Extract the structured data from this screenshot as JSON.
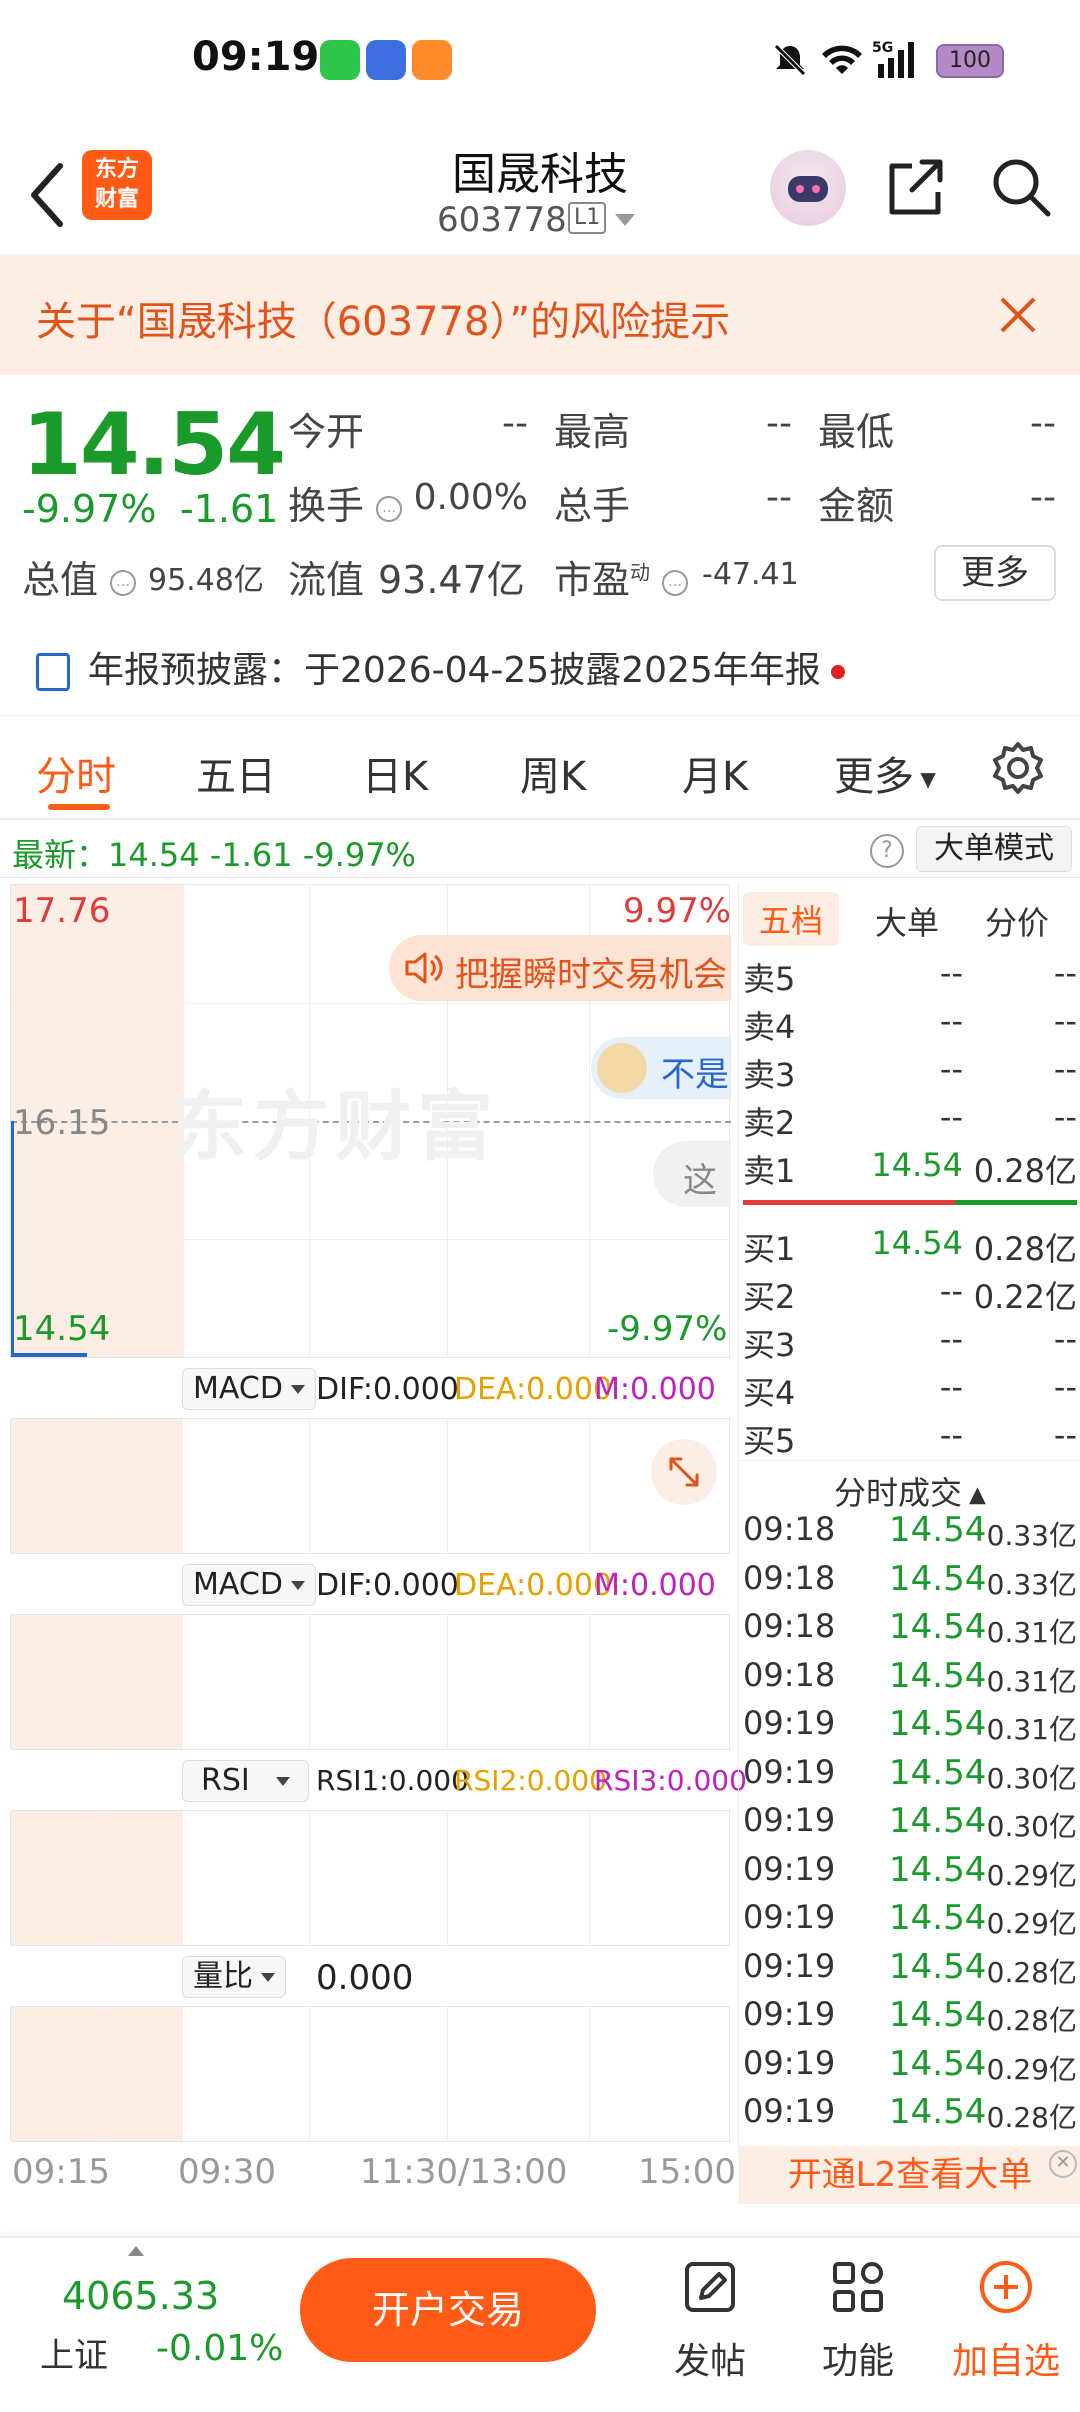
{
  "status_bar": {
    "time": "09:19",
    "battery": "100"
  },
  "header": {
    "logo": "东方\n财富",
    "title": "国晟科技",
    "code": "603778",
    "level": "L1"
  },
  "risk_banner": {
    "text": "关于“国晟科技（603778）”的风险提示"
  },
  "quote": {
    "price": "14.54",
    "change_pct": "-9.97%",
    "change": "-1.61",
    "open_label": "今开",
    "open": "--",
    "high_label": "最高",
    "high": "--",
    "low_label": "最低",
    "low": "--",
    "turnover_label": "换手",
    "turnover": "0.00%",
    "volume_label": "总手",
    "volume": "--",
    "amount_label": "金额",
    "amount": "--",
    "mktcap_label": "总值",
    "mktcap": "95.48亿",
    "float_label": "流值",
    "float": "93.47亿",
    "pe_label": "市盈",
    "pe_sup": "动",
    "pe": "-47.41",
    "more": "更多"
  },
  "notice": {
    "text": "年报预披露：于2026-04-25披露2025年年报"
  },
  "tabs": [
    "分时",
    "五日",
    "日K",
    "周K",
    "月K",
    "更多"
  ],
  "latest_row": {
    "text": "最新：14.54  -1.61  -9.97%",
    "mode": "大单模式"
  },
  "chart": {
    "top_price": "17.76",
    "top_pct": "9.97%",
    "mid_price": "16.15",
    "bottom_price": "14.54",
    "bottom_pct": "-9.97%",
    "watermark": "东方财富",
    "promo": "把握瞬时交易机会",
    "bubble1": "不是",
    "bubble2": "这",
    "x_labels": [
      "09:15",
      "09:30",
      "11:30/13:00",
      "15:00"
    ],
    "indicators": [
      {
        "name": "MACD",
        "v1": "DIF:0.000",
        "v2": "DEA:0.000",
        "v3": "M:0.000"
      },
      {
        "name": "MACD",
        "v1": "DIF:0.000",
        "v2": "DEA:0.000",
        "v3": "M:0.000"
      },
      {
        "name": "RSI",
        "v1": "RSI1:0.000",
        "v2": "RSI2:0.000",
        "v3": "RSI3:0.000"
      },
      {
        "name": "量比",
        "v1": "0.000",
        "v2": "",
        "v3": ""
      }
    ]
  },
  "depth": {
    "tabs": [
      "五档",
      "大单",
      "分价"
    ],
    "asks": [
      {
        "label": "卖5",
        "price": "--",
        "vol": "--"
      },
      {
        "label": "卖4",
        "price": "--",
        "vol": "--"
      },
      {
        "label": "卖3",
        "price": "--",
        "vol": "--"
      },
      {
        "label": "卖2",
        "price": "--",
        "vol": "--"
      },
      {
        "label": "卖1",
        "price": "14.54",
        "vol": "0.28亿"
      }
    ],
    "bids": [
      {
        "label": "买1",
        "price": "14.54",
        "vol": "0.28亿"
      },
      {
        "label": "买2",
        "price": "--",
        "vol": "0.22亿"
      },
      {
        "label": "买3",
        "price": "--",
        "vol": "--"
      },
      {
        "label": "买4",
        "price": "--",
        "vol": "--"
      },
      {
        "label": "买5",
        "price": "--",
        "vol": "--"
      }
    ],
    "trades_title": "分时成交",
    "trades": [
      {
        "t": "09:18",
        "p": "14.54",
        "v": "0.33亿"
      },
      {
        "t": "09:18",
        "p": "14.54",
        "v": "0.33亿"
      },
      {
        "t": "09:18",
        "p": "14.54",
        "v": "0.31亿"
      },
      {
        "t": "09:18",
        "p": "14.54",
        "v": "0.31亿"
      },
      {
        "t": "09:19",
        "p": "14.54",
        "v": "0.31亿"
      },
      {
        "t": "09:19",
        "p": "14.54",
        "v": "0.30亿"
      },
      {
        "t": "09:19",
        "p": "14.54",
        "v": "0.30亿"
      },
      {
        "t": "09:19",
        "p": "14.54",
        "v": "0.29亿"
      },
      {
        "t": "09:19",
        "p": "14.54",
        "v": "0.29亿"
      },
      {
        "t": "09:19",
        "p": "14.54",
        "v": "0.28亿"
      },
      {
        "t": "09:19",
        "p": "14.54",
        "v": "0.28亿"
      },
      {
        "t": "09:19",
        "p": "14.54",
        "v": "0.29亿"
      },
      {
        "t": "09:19",
        "p": "14.54",
        "v": "0.28亿"
      }
    ],
    "l2_banner": "开通L2查看大单"
  },
  "bottom_bar": {
    "index_value": "4065.33",
    "index_name": "上证",
    "index_change": "-0.01%",
    "trade_button": "开户交易",
    "post": "发帖",
    "functions": "功能",
    "add_watchlist": "加自选"
  }
}
